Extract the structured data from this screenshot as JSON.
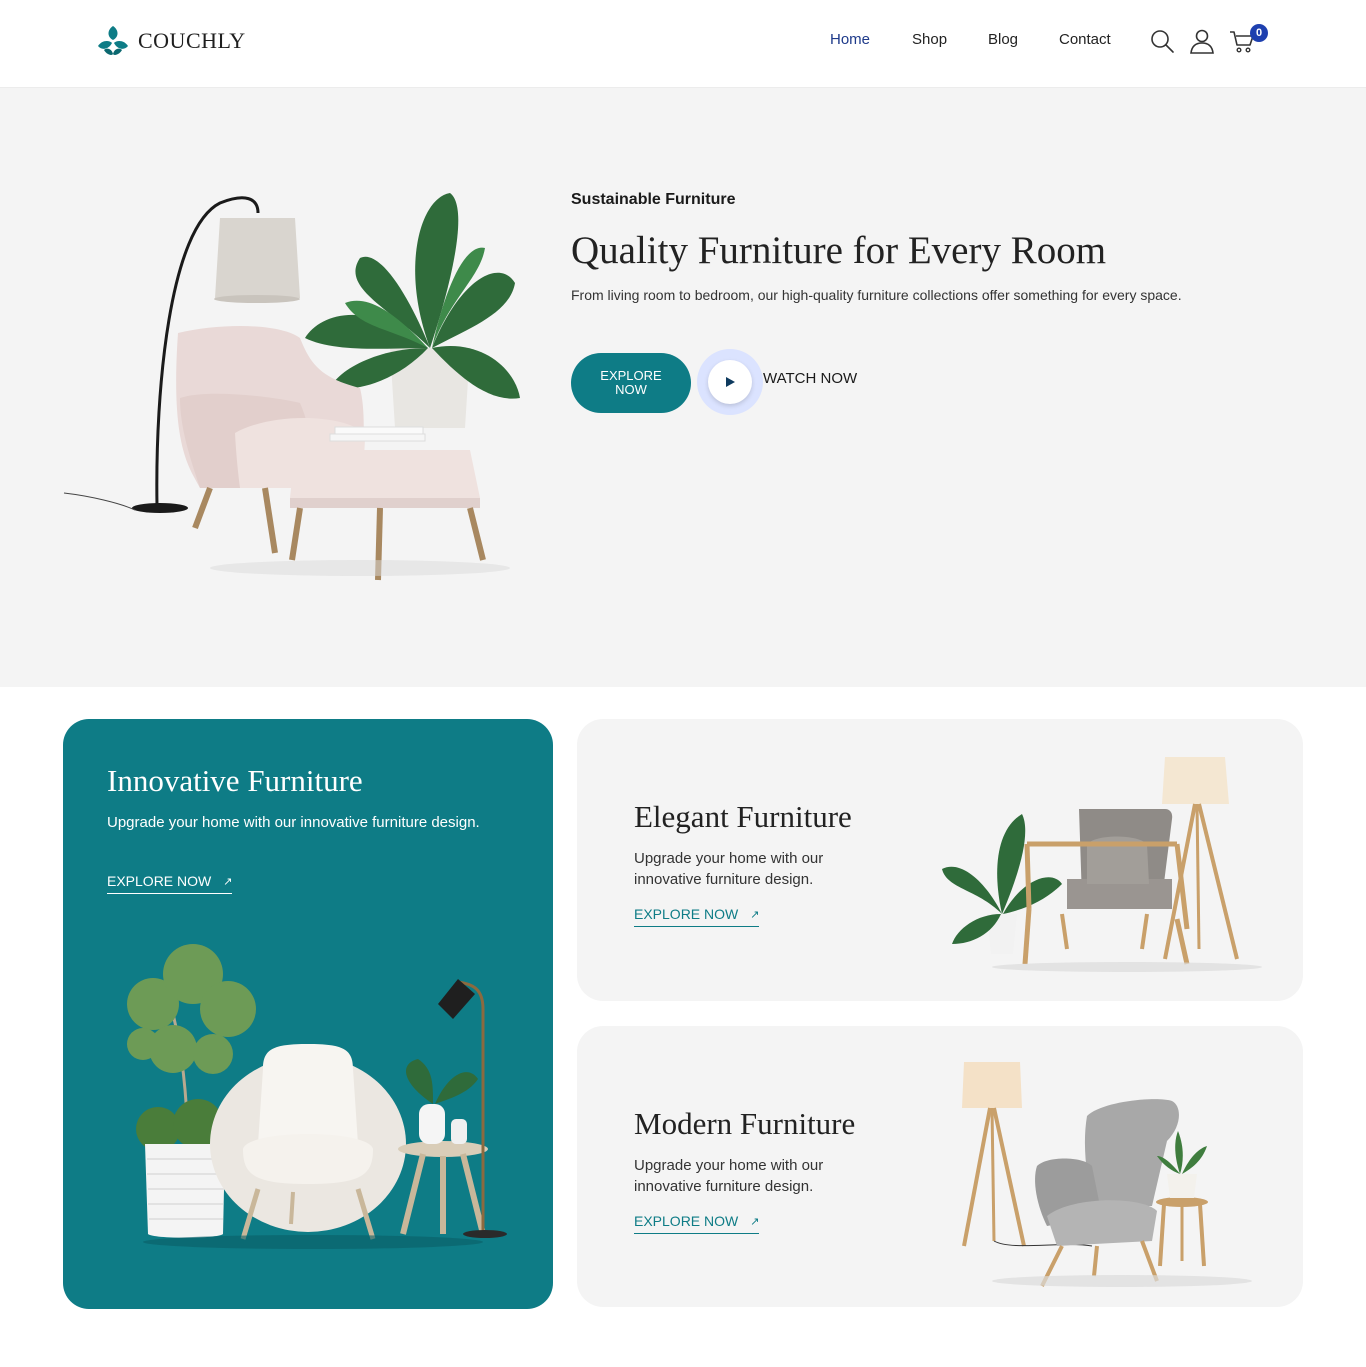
{
  "brand": {
    "name": "COUCHLY",
    "color": "#0e7c86"
  },
  "nav": {
    "items": [
      "Home",
      "Shop",
      "Blog",
      "Contact"
    ],
    "active": "Home"
  },
  "header_icons": {
    "search": "search-icon",
    "account": "user-icon",
    "cart": "cart-icon",
    "cart_count": "0"
  },
  "hero": {
    "kicker": "Sustainable Furniture",
    "title": "Quality Furniture for Every Room",
    "description": "From living room to bedroom, our high-quality furniture collections offer something for every space.",
    "explore_label": "EXPLORE NOW",
    "watch_label": "WATCH NOW"
  },
  "cards": [
    {
      "title": "Innovative Furniture",
      "description": "Upgrade your home with our innovative furniture design.",
      "link": "EXPLORE NOW",
      "arrow": "↗"
    },
    {
      "title": "Elegant Furniture",
      "description": "Upgrade your home with our innovative furniture design.",
      "link": "EXPLORE NOW",
      "arrow": "↗"
    },
    {
      "title": "Modern Furniture",
      "description": "Upgrade your home with our innovative furniture design.",
      "link": "EXPLORE NOW",
      "arrow": "↗"
    }
  ],
  "colors": {
    "accent": "#0e7c86",
    "nav_active": "#1e3a8a",
    "badge": "#1e40af",
    "hero_bg": "#f4f4f4"
  }
}
